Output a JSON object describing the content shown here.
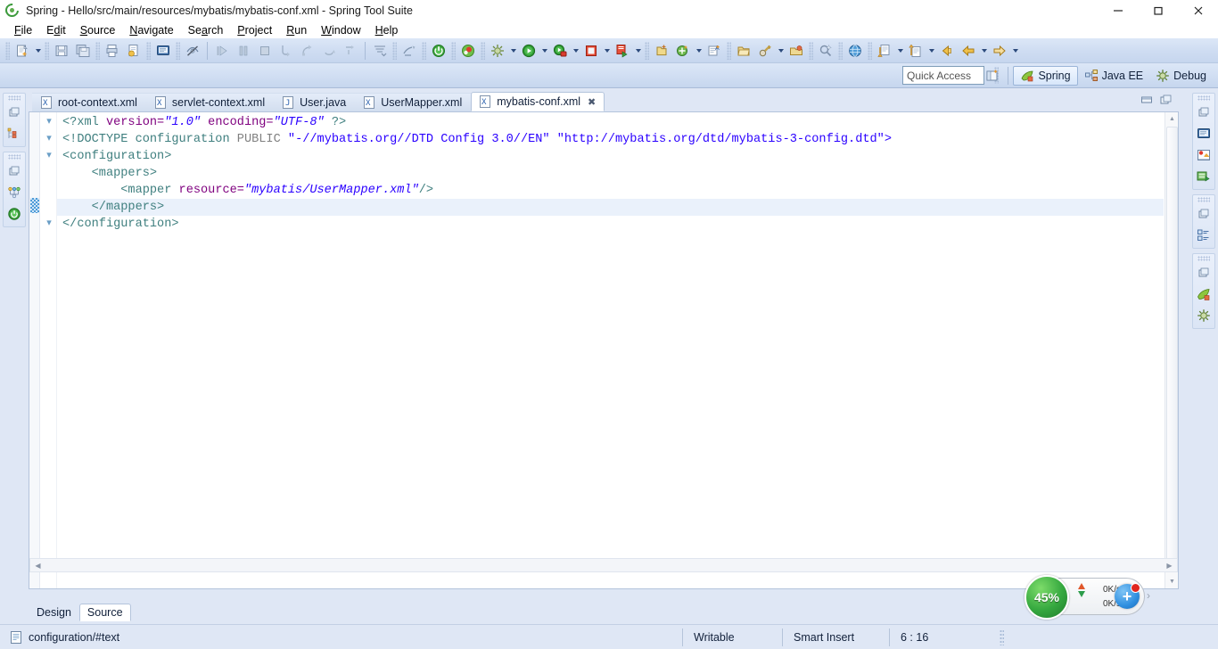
{
  "window": {
    "title": "Spring - Hello/src/main/resources/mybatis/mybatis-conf.xml - Spring Tool Suite",
    "app_icon": "spring-logo-icon",
    "minimize_label": "minimize-icon",
    "maximize_label": "restore-icon",
    "close_label": "close-icon"
  },
  "menubar": {
    "items": [
      {
        "label": "File",
        "mnemonic": "F"
      },
      {
        "label": "Edit",
        "mnemonic": "E"
      },
      {
        "label": "Source",
        "mnemonic": "S"
      },
      {
        "label": "Navigate",
        "mnemonic": "N"
      },
      {
        "label": "Search",
        "mnemonic": "a"
      },
      {
        "label": "Project",
        "mnemonic": "P"
      },
      {
        "label": "Run",
        "mnemonic": "R"
      },
      {
        "label": "Window",
        "mnemonic": "W"
      },
      {
        "label": "Help",
        "mnemonic": "H"
      }
    ]
  },
  "toolbar": {
    "groups": [
      {
        "buttons": [
          {
            "icon": "new-wizard-icon",
            "dropdown": true
          }
        ]
      },
      {
        "buttons": [
          {
            "icon": "save-icon"
          },
          {
            "icon": "save-all-icon"
          }
        ]
      },
      {
        "buttons": [
          {
            "icon": "print-icon"
          },
          {
            "icon": "validate-icon"
          }
        ]
      },
      {
        "buttons": [
          {
            "icon": "console-icon"
          }
        ]
      },
      {
        "buttons": [
          {
            "icon": "toggle-mark-occurrences-icon"
          }
        ]
      },
      {
        "buttons": [
          {
            "icon": "step-resume-icon"
          },
          {
            "icon": "suspend-icon"
          },
          {
            "icon": "terminate-icon"
          },
          {
            "icon": "step-into-icon"
          },
          {
            "icon": "step-over-icon"
          },
          {
            "icon": "step-return-icon"
          },
          {
            "icon": "drop-to-frame-icon"
          }
        ]
      },
      {
        "buttons": [
          {
            "icon": "use-step-filters-icon"
          }
        ]
      },
      {
        "buttons": [
          {
            "icon": "boot-dashboard-icon"
          }
        ]
      },
      {
        "buttons": [
          {
            "icon": "spring-boot-app-icon"
          }
        ]
      },
      {
        "buttons": [
          {
            "icon": "debug-icon",
            "dropdown": true
          },
          {
            "icon": "run-icon",
            "dropdown": true
          },
          {
            "icon": "run-external-tools-icon",
            "dropdown": true
          },
          {
            "icon": "stop-icon",
            "dropdown": true
          },
          {
            "icon": "run-last-tool-icon",
            "dropdown": true
          }
        ]
      },
      {
        "buttons": [
          {
            "icon": "new-java-package-icon"
          },
          {
            "icon": "new-class-icon",
            "dropdown": true
          },
          {
            "icon": "new-annotation-icon"
          }
        ]
      },
      {
        "buttons": [
          {
            "icon": "open-type-icon"
          }
        ]
      },
      {
        "buttons": [
          {
            "icon": "open-folder-icon"
          },
          {
            "icon": "search-icon",
            "dropdown": true
          },
          {
            "icon": "open-task-icon"
          }
        ]
      },
      {
        "buttons": [
          {
            "icon": "link-search-icon"
          }
        ]
      },
      {
        "buttons": [
          {
            "icon": "open-web-browser-icon"
          }
        ]
      },
      {
        "buttons": [
          {
            "icon": "next-annotation-icon",
            "dropdown": true
          },
          {
            "icon": "previous-annotation-icon",
            "dropdown": true
          }
        ]
      },
      {
        "buttons": [
          {
            "icon": "back-yellow-icon"
          },
          {
            "icon": "back-icon",
            "dropdown": true
          },
          {
            "icon": "forward-icon",
            "dropdown": true
          }
        ]
      }
    ]
  },
  "quick_access": {
    "placeholder": "Quick Access",
    "value": "",
    "open_perspective_icon": "open-perspective-icon",
    "perspectives": [
      {
        "label": "Spring",
        "icon": "spring-perspective-icon",
        "active": true
      },
      {
        "label": "Java EE",
        "icon": "javaee-perspective-icon",
        "active": false
      },
      {
        "label": "Debug",
        "icon": "debug-perspective-icon",
        "active": false
      }
    ]
  },
  "fastview_left": {
    "groups": [
      {
        "items": [
          {
            "icon": "restore-view-icon"
          },
          {
            "icon": "package-explorer-icon"
          }
        ]
      },
      {
        "items": [
          {
            "icon": "restore-view-icon"
          },
          {
            "icon": "outline-icon"
          },
          {
            "icon": "boot-dashboard-green-icon"
          }
        ]
      }
    ]
  },
  "fastview_right": {
    "groups": [
      {
        "items": [
          {
            "icon": "restore-view-icon"
          },
          {
            "icon": "console-view-icon"
          },
          {
            "icon": "problems-view-icon"
          },
          {
            "icon": "servers-view-icon"
          }
        ]
      },
      {
        "items": [
          {
            "icon": "restore-view-icon"
          },
          {
            "icon": "outline-view-icon"
          }
        ]
      },
      {
        "items": [
          {
            "icon": "restore-view-icon"
          },
          {
            "icon": "spring-explorer-icon"
          },
          {
            "icon": "debug-bug-icon"
          }
        ]
      }
    ]
  },
  "editor": {
    "tabs": [
      {
        "label": "root-context.xml",
        "icon": "xml-file-icon",
        "active": false,
        "closable": false
      },
      {
        "label": "servlet-context.xml",
        "icon": "xml-file-icon",
        "active": false,
        "closable": false
      },
      {
        "label": "User.java",
        "icon": "java-file-icon",
        "active": false,
        "closable": false
      },
      {
        "label": "UserMapper.xml",
        "icon": "xml-file-icon",
        "active": false,
        "closable": false
      },
      {
        "label": "mybatis-conf.xml",
        "icon": "xml-file-icon",
        "active": true,
        "closable": true
      }
    ],
    "close_glyph": "✖",
    "minimize_icon": "minimize-editor-icon",
    "maximize_icon": "maximize-editor-icon",
    "bottom_tabs": [
      {
        "label": "Design",
        "active": false
      },
      {
        "label": "Source",
        "active": true
      }
    ],
    "current_line": 6,
    "code_lines": [
      {
        "n": 1,
        "current": false,
        "fold": true,
        "tokens": [
          {
            "t": "<?xml ",
            "c": "t-tag"
          },
          {
            "t": "version=",
            "c": "t-attr"
          },
          {
            "t": "\"1.0\"",
            "c": "t-str"
          },
          {
            "t": " encoding=",
            "c": "t-attr"
          },
          {
            "t": "\"UTF-8\"",
            "c": "t-str"
          },
          {
            "t": " ?>",
            "c": "t-tag"
          }
        ]
      },
      {
        "n": 2,
        "current": false,
        "fold": true,
        "tokens": [
          {
            "t": "<!DOCTYPE configuration ",
            "c": "t-tag"
          },
          {
            "t": "PUBLIC ",
            "c": "t-kw"
          },
          {
            "t": "\"-//mybatis.org//DTD Config 3.0//EN\" \"http://mybatis.org/dtd/mybatis-3-config.dtd\">",
            "c": "t-dq"
          }
        ]
      },
      {
        "n": 3,
        "current": false,
        "fold": true,
        "tokens": [
          {
            "t": "<configuration>",
            "c": "t-tag"
          }
        ]
      },
      {
        "n": 4,
        "current": false,
        "fold": false,
        "tokens": [
          {
            "t": "    <mappers>",
            "c": "t-tag"
          }
        ]
      },
      {
        "n": 5,
        "current": false,
        "fold": false,
        "tokens": [
          {
            "t": "        <mapper ",
            "c": "t-tag"
          },
          {
            "t": "resource=",
            "c": "t-attr"
          },
          {
            "t": "\"mybatis/UserMapper.xml\"",
            "c": "t-str"
          },
          {
            "t": "/>",
            "c": "t-tag"
          }
        ]
      },
      {
        "n": 6,
        "current": true,
        "fold": false,
        "tokens": [
          {
            "t": "    </mappers>",
            "c": "t-tag"
          }
        ]
      },
      {
        "n": 7,
        "current": false,
        "fold": true,
        "tokens": [
          {
            "t": "</configuration>",
            "c": "t-tag"
          }
        ]
      }
    ]
  },
  "statusbar": {
    "selection_icon": "xml-node-icon",
    "selection": "configuration/#text",
    "writable": "Writable",
    "insert_mode": "Smart Insert",
    "cursor_position": "6 : 16"
  },
  "speed_widget": {
    "percent": "45%",
    "upload": "0K/s",
    "download": "0K/s",
    "plus_label": "+",
    "expand_glyph": "›",
    "circle_color": "#35a83f",
    "plus_color": "#2f8fe0",
    "badge_color": "#e0261f"
  }
}
